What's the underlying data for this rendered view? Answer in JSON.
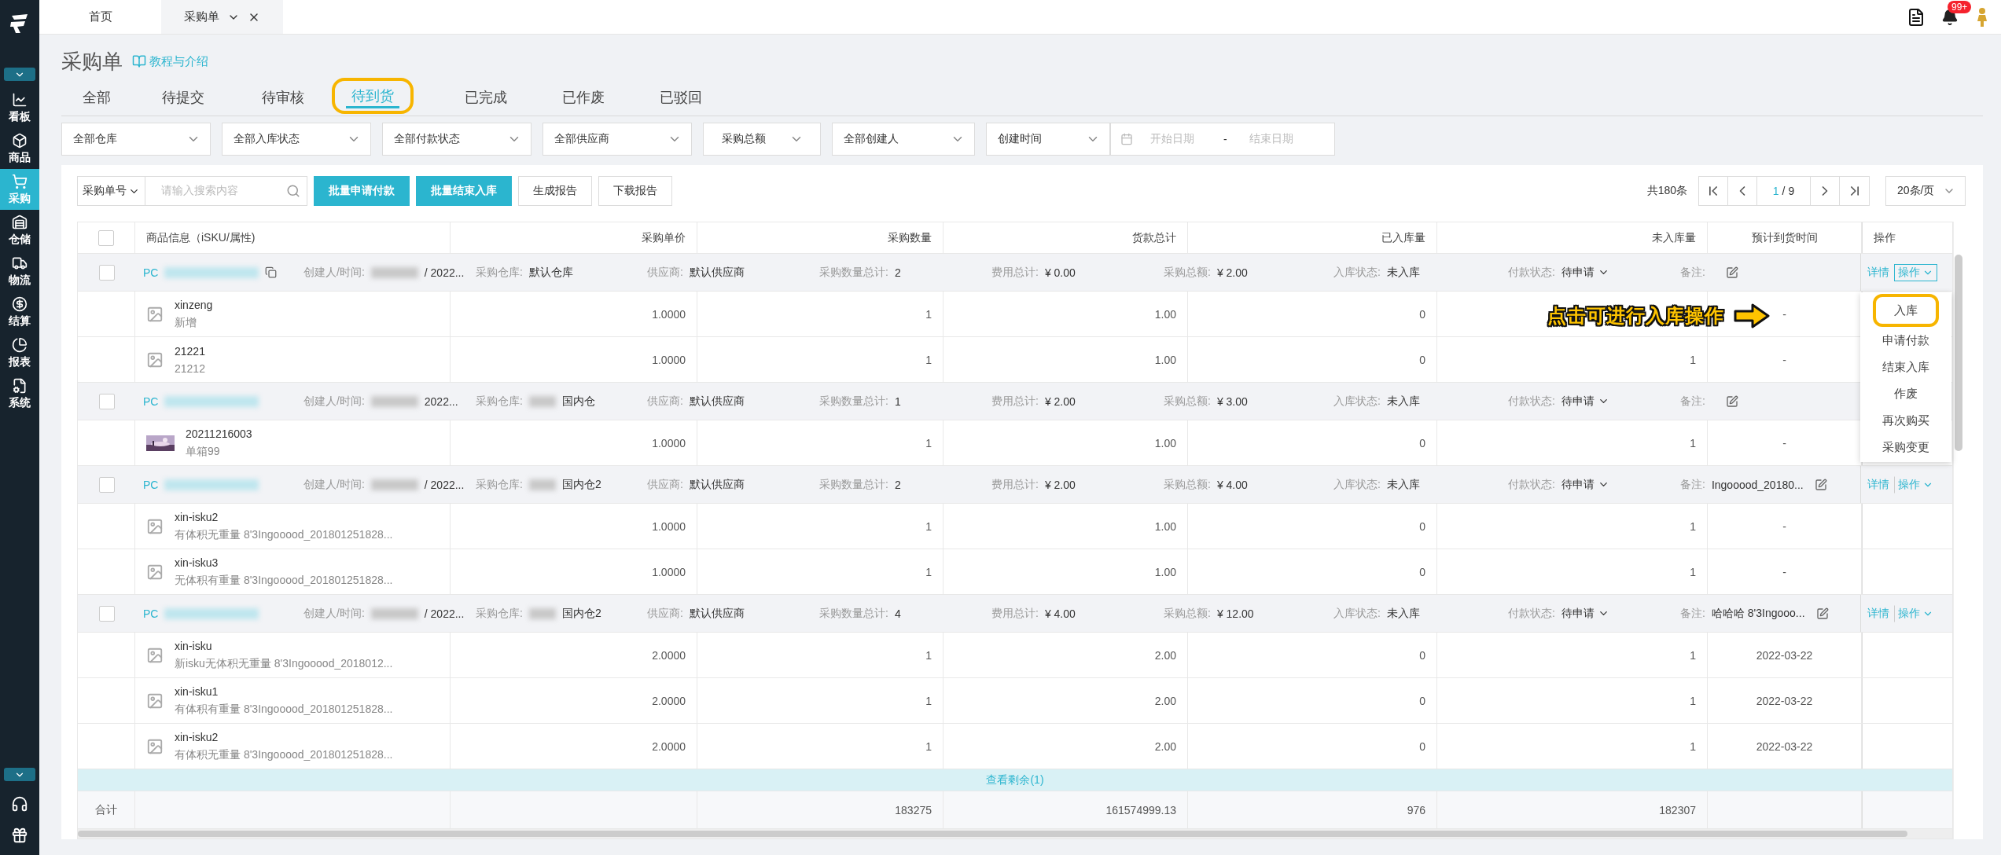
{
  "sidebar": {
    "items": [
      {
        "label": "看板",
        "kind": "dashboard",
        "selected": false
      },
      {
        "label": "商品",
        "kind": "goods",
        "selected": false
      },
      {
        "label": "采购",
        "kind": "purchase",
        "selected": true
      },
      {
        "label": "仓储",
        "kind": "storage",
        "selected": false
      },
      {
        "label": "物流",
        "kind": "logistics",
        "selected": false
      },
      {
        "label": "结算",
        "kind": "settlement",
        "selected": false
      },
      {
        "label": "报表",
        "kind": "report",
        "selected": false
      },
      {
        "label": "系统",
        "kind": "system",
        "selected": false
      }
    ]
  },
  "top_tabs": [
    {
      "label": "首页",
      "selected": false,
      "closable": false
    },
    {
      "label": "采购单",
      "selected": true,
      "closable": true
    }
  ],
  "notification_badge": "99+",
  "page": {
    "title": "采购单",
    "help_link": "教程与介绍"
  },
  "status_tabs": [
    {
      "label": "全部",
      "selected": false,
      "highlighted": false
    },
    {
      "label": "待提交",
      "selected": false,
      "highlighted": false
    },
    {
      "label": "待审核",
      "selected": false,
      "highlighted": false
    },
    {
      "label": "待到货",
      "selected": true,
      "highlighted": true
    },
    {
      "label": "已完成",
      "selected": false,
      "highlighted": false
    },
    {
      "label": "已作废",
      "selected": false,
      "highlighted": false
    },
    {
      "label": "已驳回",
      "selected": false,
      "highlighted": false
    }
  ],
  "filters": [
    {
      "kind": "select",
      "label": "全部仓库"
    },
    {
      "kind": "select",
      "label": "全部入库状态"
    },
    {
      "kind": "select",
      "label": "全部付款状态"
    },
    {
      "kind": "select",
      "label": "全部供应商"
    },
    {
      "kind": "range",
      "label": "采购总额"
    },
    {
      "kind": "select",
      "label": "全部创建人"
    },
    {
      "kind": "select",
      "label": "创建时间"
    },
    {
      "kind": "date_range",
      "start_placeholder": "开始日期",
      "separator": "-",
      "end_placeholder": "结束日期"
    }
  ],
  "toolbar": {
    "search_field": "采购单号",
    "search_placeholder": "请输入搜索内容",
    "buttons": [
      {
        "label": "批量申请付款",
        "primary": true
      },
      {
        "label": "批量结束入库",
        "primary": true
      },
      {
        "label": "生成报告",
        "primary": false
      },
      {
        "label": "下载报告",
        "primary": false
      }
    ],
    "total": "共180条",
    "page_current": "1",
    "page_total": "/ 9",
    "page_size": "20条/页"
  },
  "table": {
    "select_all_checked": false,
    "columns": [
      "商品信息（iSKU/属性)",
      "采购单价",
      "采购数量",
      "货款总计",
      "已入库量",
      "未入库量",
      "预计到货时间",
      "操作"
    ],
    "groups": [
      {
        "checked": false,
        "fields": [
          {
            "kind": "order",
            "value": "PC",
            "copy_icon": true
          },
          {
            "kind": "text",
            "label": "创建人/时间:",
            "value": "/ 2022...",
            "redacted": true
          },
          {
            "kind": "text",
            "label": "采购仓库:",
            "value": "默认仓库"
          },
          {
            "kind": "text",
            "label": "供应商:",
            "value": "默认供应商"
          },
          {
            "kind": "text",
            "label": "采购数量总计:",
            "value": "2"
          },
          {
            "kind": "text",
            "label": "费用总计:",
            "value": "¥ 0.00"
          },
          {
            "kind": "text",
            "label": "采购总额:",
            "value": "¥ 2.00"
          },
          {
            "kind": "text",
            "label": "入库状态:",
            "value": "未入库"
          },
          {
            "kind": "select",
            "label": "付款状态:",
            "value": "待申请"
          },
          {
            "kind": "note",
            "label": "备注:"
          }
        ],
        "actions": {
          "details": "详情",
          "ops": "操作",
          "open": true
        },
        "items": [
          {
            "kind": "placeholder",
            "name": "xinzeng",
            "attr": "新增",
            "price": "1.0000",
            "qty": "1",
            "amount": "1.00",
            "received": "0",
            "eta": "-"
          },
          {
            "kind": "placeholder",
            "name": "21221",
            "attr": "21212",
            "price": "1.0000",
            "qty": "1",
            "amount": "1.00",
            "received": "0",
            "pending": "1",
            "eta": "-"
          }
        ]
      },
      {
        "checked": false,
        "fields": [
          {
            "kind": "order",
            "value": "PC"
          },
          {
            "kind": "text",
            "label": "创建人/时间:",
            "value": "2022...",
            "redacted": true
          },
          {
            "kind": "text",
            "label": "采购仓库:",
            "value": "国内仓",
            "redacted": true
          },
          {
            "kind": "text",
            "label": "供应商:",
            "value": "默认供应商"
          },
          {
            "kind": "text",
            "label": "采购数量总计:",
            "value": "1"
          },
          {
            "kind": "text",
            "label": "费用总计:",
            "value": "¥ 2.00"
          },
          {
            "kind": "text",
            "label": "采购总额:",
            "value": "¥ 3.00"
          },
          {
            "kind": "text",
            "label": "入库状态:",
            "value": "未入库"
          },
          {
            "kind": "select",
            "label": "付款状态:",
            "value": "待申请"
          },
          {
            "kind": "note",
            "label": "备注:"
          }
        ],
        "items": [
          {
            "kind": "picture",
            "name": "20211216003",
            "attr": "单箱99",
            "price": "1.0000",
            "qty": "1",
            "amount": "1.00",
            "received": "0",
            "pending": "1",
            "eta": "-"
          }
        ]
      },
      {
        "checked": false,
        "fields": [
          {
            "kind": "order",
            "value": "PC"
          },
          {
            "kind": "text",
            "label": "创建人/时间:",
            "value": "/ 2022...",
            "redacted": true
          },
          {
            "kind": "text",
            "label": "采购仓库:",
            "value": "国内仓2",
            "redacted": true
          },
          {
            "kind": "text",
            "label": "供应商:",
            "value": "默认供应商"
          },
          {
            "kind": "text",
            "label": "采购数量总计:",
            "value": "2"
          },
          {
            "kind": "text",
            "label": "费用总计:",
            "value": "¥ 2.00"
          },
          {
            "kind": "text",
            "label": "采购总额:",
            "value": "¥ 4.00"
          },
          {
            "kind": "text",
            "label": "入库状态:",
            "value": "未入库"
          },
          {
            "kind": "select",
            "label": "付款状态:",
            "value": "待申请"
          },
          {
            "kind": "note",
            "label": "备注:",
            "value": "Ingooood_20180..."
          }
        ],
        "actions": {
          "details": "详情",
          "ops": "操作",
          "open": false
        },
        "items": [
          {
            "kind": "placeholder",
            "name": "xin-isku2",
            "attr": "有体积无重量 8'3Ingooood_201801251828...",
            "price": "1.0000",
            "qty": "1",
            "amount": "1.00",
            "received": "0",
            "pending": "1",
            "eta": "-"
          },
          {
            "kind": "placeholder",
            "name": "xin-isku3",
            "attr": "无体积有重量 8'3Ingooood_201801251828...",
            "price": "1.0000",
            "qty": "1",
            "amount": "1.00",
            "received": "0",
            "pending": "1",
            "eta": "-"
          }
        ]
      },
      {
        "checked": false,
        "fields": [
          {
            "kind": "order",
            "value": "PC"
          },
          {
            "kind": "text",
            "label": "创建人/时间:",
            "value": "/ 2022...",
            "redacted": true
          },
          {
            "kind": "text",
            "label": "采购仓库:",
            "value": "国内仓2",
            "redacted": true
          },
          {
            "kind": "text",
            "label": "供应商:",
            "value": "默认供应商"
          },
          {
            "kind": "text",
            "label": "采购数量总计:",
            "value": "4"
          },
          {
            "kind": "text",
            "label": "费用总计:",
            "value": "¥ 4.00"
          },
          {
            "kind": "text",
            "label": "采购总额:",
            "value": "¥ 12.00"
          },
          {
            "kind": "text",
            "label": "入库状态:",
            "value": "未入库"
          },
          {
            "kind": "select",
            "label": "付款状态:",
            "value": "待申请"
          },
          {
            "kind": "note",
            "label": "备注:",
            "value": "哈哈哈 8'3Ingooo..."
          }
        ],
        "actions": {
          "details": "详情",
          "ops": "操作",
          "open": false
        },
        "items": [
          {
            "kind": "placeholder",
            "name": "xin-isku",
            "attr": "新isku无体积无重量 8'3Ingooood_2018012...",
            "price": "2.0000",
            "qty": "1",
            "amount": "2.00",
            "received": "0",
            "pending": "1",
            "eta": "2022-03-22"
          },
          {
            "kind": "placeholder",
            "name": "xin-isku1",
            "attr": "有体积有重量 8'3Ingooood_201801251828...",
            "price": "2.0000",
            "qty": "1",
            "amount": "2.00",
            "received": "0",
            "pending": "1",
            "eta": "2022-03-22"
          },
          {
            "kind": "placeholder",
            "name": "xin-isku2",
            "attr": "有体积无重量 8'3Ingooood_201801251828...",
            "price": "2.0000",
            "qty": "1",
            "amount": "2.00",
            "received": "0",
            "pending": "1",
            "eta": "2022-03-22"
          }
        ]
      }
    ],
    "more_link": "查看剩余(1)",
    "totals": {
      "label": "合计",
      "qty": "183275",
      "amount": "161574999.13",
      "received": "976",
      "pending": "182307"
    }
  },
  "dropdown": {
    "items": [
      {
        "label": "入库",
        "highlighted": true
      },
      {
        "label": "申请付款",
        "highlighted": false
      },
      {
        "label": "结束入库",
        "highlighted": false
      },
      {
        "label": "作废",
        "highlighted": false
      },
      {
        "label": "再次购买",
        "highlighted": false
      },
      {
        "label": "采购变更",
        "highlighted": false
      }
    ]
  },
  "annotation": {
    "text": "点击可进行入库操作"
  }
}
